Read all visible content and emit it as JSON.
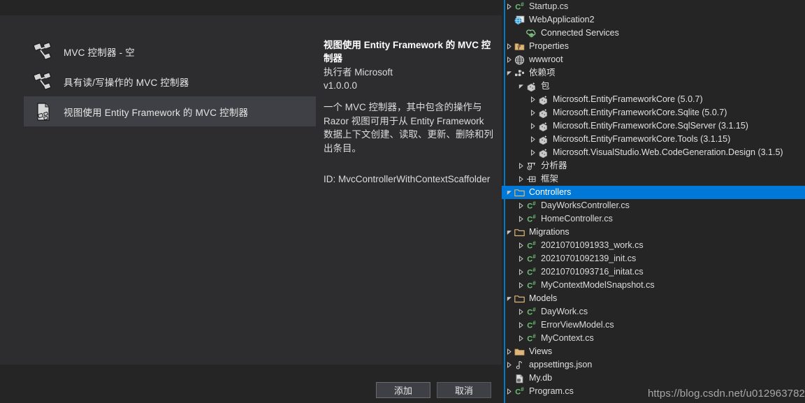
{
  "dialog": {
    "scaffold_items": [
      {
        "label": "MVC 控制器 - 空",
        "icon": "mvc-controller-icon",
        "selected": false
      },
      {
        "label": "具有读/写操作的 MVC 控制器",
        "icon": "mvc-controller-icon",
        "selected": false
      },
      {
        "label": "视图使用 Entity Framework 的 MVC 控制器",
        "icon": "mvc-controller-ef-icon",
        "selected": true
      }
    ],
    "description": {
      "title": "视图使用 Entity Framework 的 MVC 控制器",
      "author": "执行者 Microsoft",
      "version": "v1.0.0.0",
      "body": "一个 MVC 控制器，其中包含的操作与 Razor 视图可用于从 Entity Framework 数据上下文创建、读取、更新、删除和列出条目。",
      "id": "ID: MvcControllerWithContextScaffolder"
    },
    "buttons": {
      "add": "添加",
      "cancel": "取消"
    }
  },
  "solution_explorer": {
    "watermark": "https://blog.csdn.net/u012963782",
    "tree": [
      {
        "label": "Startup.cs",
        "indent": 1,
        "twisty": "collapsed",
        "icon": "csharp-file-icon",
        "selected": false
      },
      {
        "label": "WebApplication2",
        "indent": 1,
        "twisty": "none",
        "icon": "web-project-icon",
        "selected": false
      },
      {
        "label": "Connected Services",
        "indent": 2,
        "twisty": "none",
        "icon": "connected-services-icon",
        "selected": false
      },
      {
        "label": "Properties",
        "indent": 1,
        "twisty": "collapsed",
        "icon": "properties-folder-icon",
        "selected": false
      },
      {
        "label": "wwwroot",
        "indent": 1,
        "twisty": "collapsed",
        "icon": "wwwroot-globe-icon",
        "selected": false
      },
      {
        "label": "依赖项",
        "indent": 1,
        "twisty": "expanded",
        "icon": "dependencies-icon",
        "selected": false
      },
      {
        "label": "包",
        "indent": 2,
        "twisty": "expanded",
        "icon": "package-icon",
        "selected": false
      },
      {
        "label": "Microsoft.EntityFrameworkCore (5.0.7)",
        "indent": 3,
        "twisty": "collapsed",
        "icon": "package-icon",
        "selected": false
      },
      {
        "label": "Microsoft.EntityFrameworkCore.Sqlite (5.0.7)",
        "indent": 3,
        "twisty": "collapsed",
        "icon": "package-icon",
        "selected": false
      },
      {
        "label": "Microsoft.EntityFrameworkCore.SqlServer (3.1.15)",
        "indent": 3,
        "twisty": "collapsed",
        "icon": "package-icon",
        "selected": false
      },
      {
        "label": "Microsoft.EntityFrameworkCore.Tools (3.1.15)",
        "indent": 3,
        "twisty": "collapsed",
        "icon": "package-icon",
        "selected": false
      },
      {
        "label": "Microsoft.VisualStudio.Web.CodeGeneration.Design (3.1.5)",
        "indent": 3,
        "twisty": "collapsed",
        "icon": "package-icon",
        "selected": false
      },
      {
        "label": "分析器",
        "indent": 2,
        "twisty": "collapsed",
        "icon": "analyzer-icon",
        "selected": false
      },
      {
        "label": "框架",
        "indent": 2,
        "twisty": "collapsed",
        "icon": "framework-icon",
        "selected": false
      },
      {
        "label": "Controllers",
        "indent": 1,
        "twisty": "expanded",
        "icon": "folder-icon",
        "selected": true
      },
      {
        "label": "DayWorksController.cs",
        "indent": 2,
        "twisty": "collapsed",
        "icon": "csharp-file-icon",
        "selected": false
      },
      {
        "label": "HomeController.cs",
        "indent": 2,
        "twisty": "collapsed",
        "icon": "csharp-file-icon",
        "selected": false
      },
      {
        "label": "Migrations",
        "indent": 1,
        "twisty": "expanded",
        "icon": "folder-icon",
        "selected": false
      },
      {
        "label": "20210701091933_work.cs",
        "indent": 2,
        "twisty": "collapsed",
        "icon": "csharp-file-icon",
        "selected": false
      },
      {
        "label": "20210701092139_init.cs",
        "indent": 2,
        "twisty": "collapsed",
        "icon": "csharp-file-icon",
        "selected": false
      },
      {
        "label": "20210701093716_initat.cs",
        "indent": 2,
        "twisty": "collapsed",
        "icon": "csharp-file-icon",
        "selected": false
      },
      {
        "label": "MyContextModelSnapshot.cs",
        "indent": 2,
        "twisty": "collapsed",
        "icon": "csharp-file-icon",
        "selected": false
      },
      {
        "label": "Models",
        "indent": 1,
        "twisty": "expanded",
        "icon": "folder-icon",
        "selected": false
      },
      {
        "label": "DayWork.cs",
        "indent": 2,
        "twisty": "collapsed",
        "icon": "csharp-file-icon",
        "selected": false
      },
      {
        "label": "ErrorViewModel.cs",
        "indent": 2,
        "twisty": "collapsed",
        "icon": "csharp-file-icon",
        "selected": false
      },
      {
        "label": "MyContext.cs",
        "indent": 2,
        "twisty": "collapsed",
        "icon": "csharp-file-icon",
        "selected": false
      },
      {
        "label": "Views",
        "indent": 1,
        "twisty": "collapsed",
        "icon": "folder-closed-icon",
        "selected": false
      },
      {
        "label": "appsettings.json",
        "indent": 1,
        "twisty": "collapsed",
        "icon": "json-file-icon",
        "selected": false
      },
      {
        "label": "My.db",
        "indent": 1,
        "twisty": "none",
        "icon": "db-file-icon",
        "selected": false
      },
      {
        "label": "Program.cs",
        "indent": 1,
        "twisty": "collapsed",
        "icon": "csharp-file-icon",
        "selected": false
      }
    ]
  },
  "colors": {
    "selection_blue": "#0078d7",
    "accent_line": "#007acc",
    "dialog_bg": "#2d2d30",
    "window_bg": "#252526",
    "csharp_green": "#6fbf73",
    "folder_orange": "#dcb67a"
  }
}
